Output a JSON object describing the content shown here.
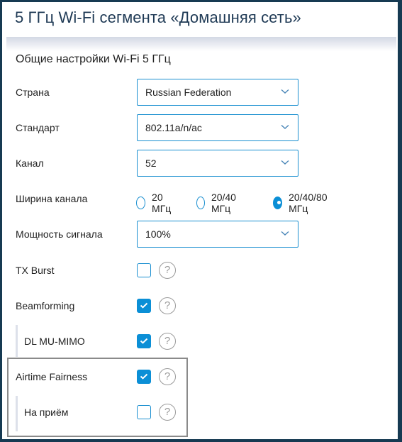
{
  "header": {
    "title": "5 ГГц Wi-Fi сегмента «Домашняя сеть»"
  },
  "section": {
    "title": "Общие настройки Wi-Fi 5 ГГц"
  },
  "fields": {
    "country": {
      "label": "Страна",
      "value": "Russian Federation"
    },
    "standard": {
      "label": "Стандарт",
      "value": "802.11a/n/ac"
    },
    "channel": {
      "label": "Канал",
      "value": "52"
    },
    "bandwidth": {
      "label": "Ширина канала",
      "options": [
        {
          "label": "20 МГц",
          "selected": false
        },
        {
          "label": "20/40 МГц",
          "selected": false
        },
        {
          "label": "20/40/80 МГц",
          "selected": true
        }
      ]
    },
    "power": {
      "label": "Мощность сигнала",
      "value": "100%"
    },
    "tx_burst": {
      "label": "TX Burst",
      "checked": false
    },
    "beamforming": {
      "label": "Beamforming",
      "checked": true
    },
    "dl_mu_mimo": {
      "label": "DL MU-MIMO",
      "checked": true
    },
    "airtime_fairness": {
      "label": "Airtime Fairness",
      "checked": true
    },
    "receive": {
      "label": "На приём",
      "checked": false
    }
  },
  "icons": {
    "help": "?",
    "select_arrow": "chevron-down-icon",
    "check": "checkmark-icon"
  },
  "colors": {
    "accent": "#0b8fd6",
    "frame": "#163a52",
    "title": "#1f3a55",
    "highlight_border": "#8a8a8a"
  }
}
